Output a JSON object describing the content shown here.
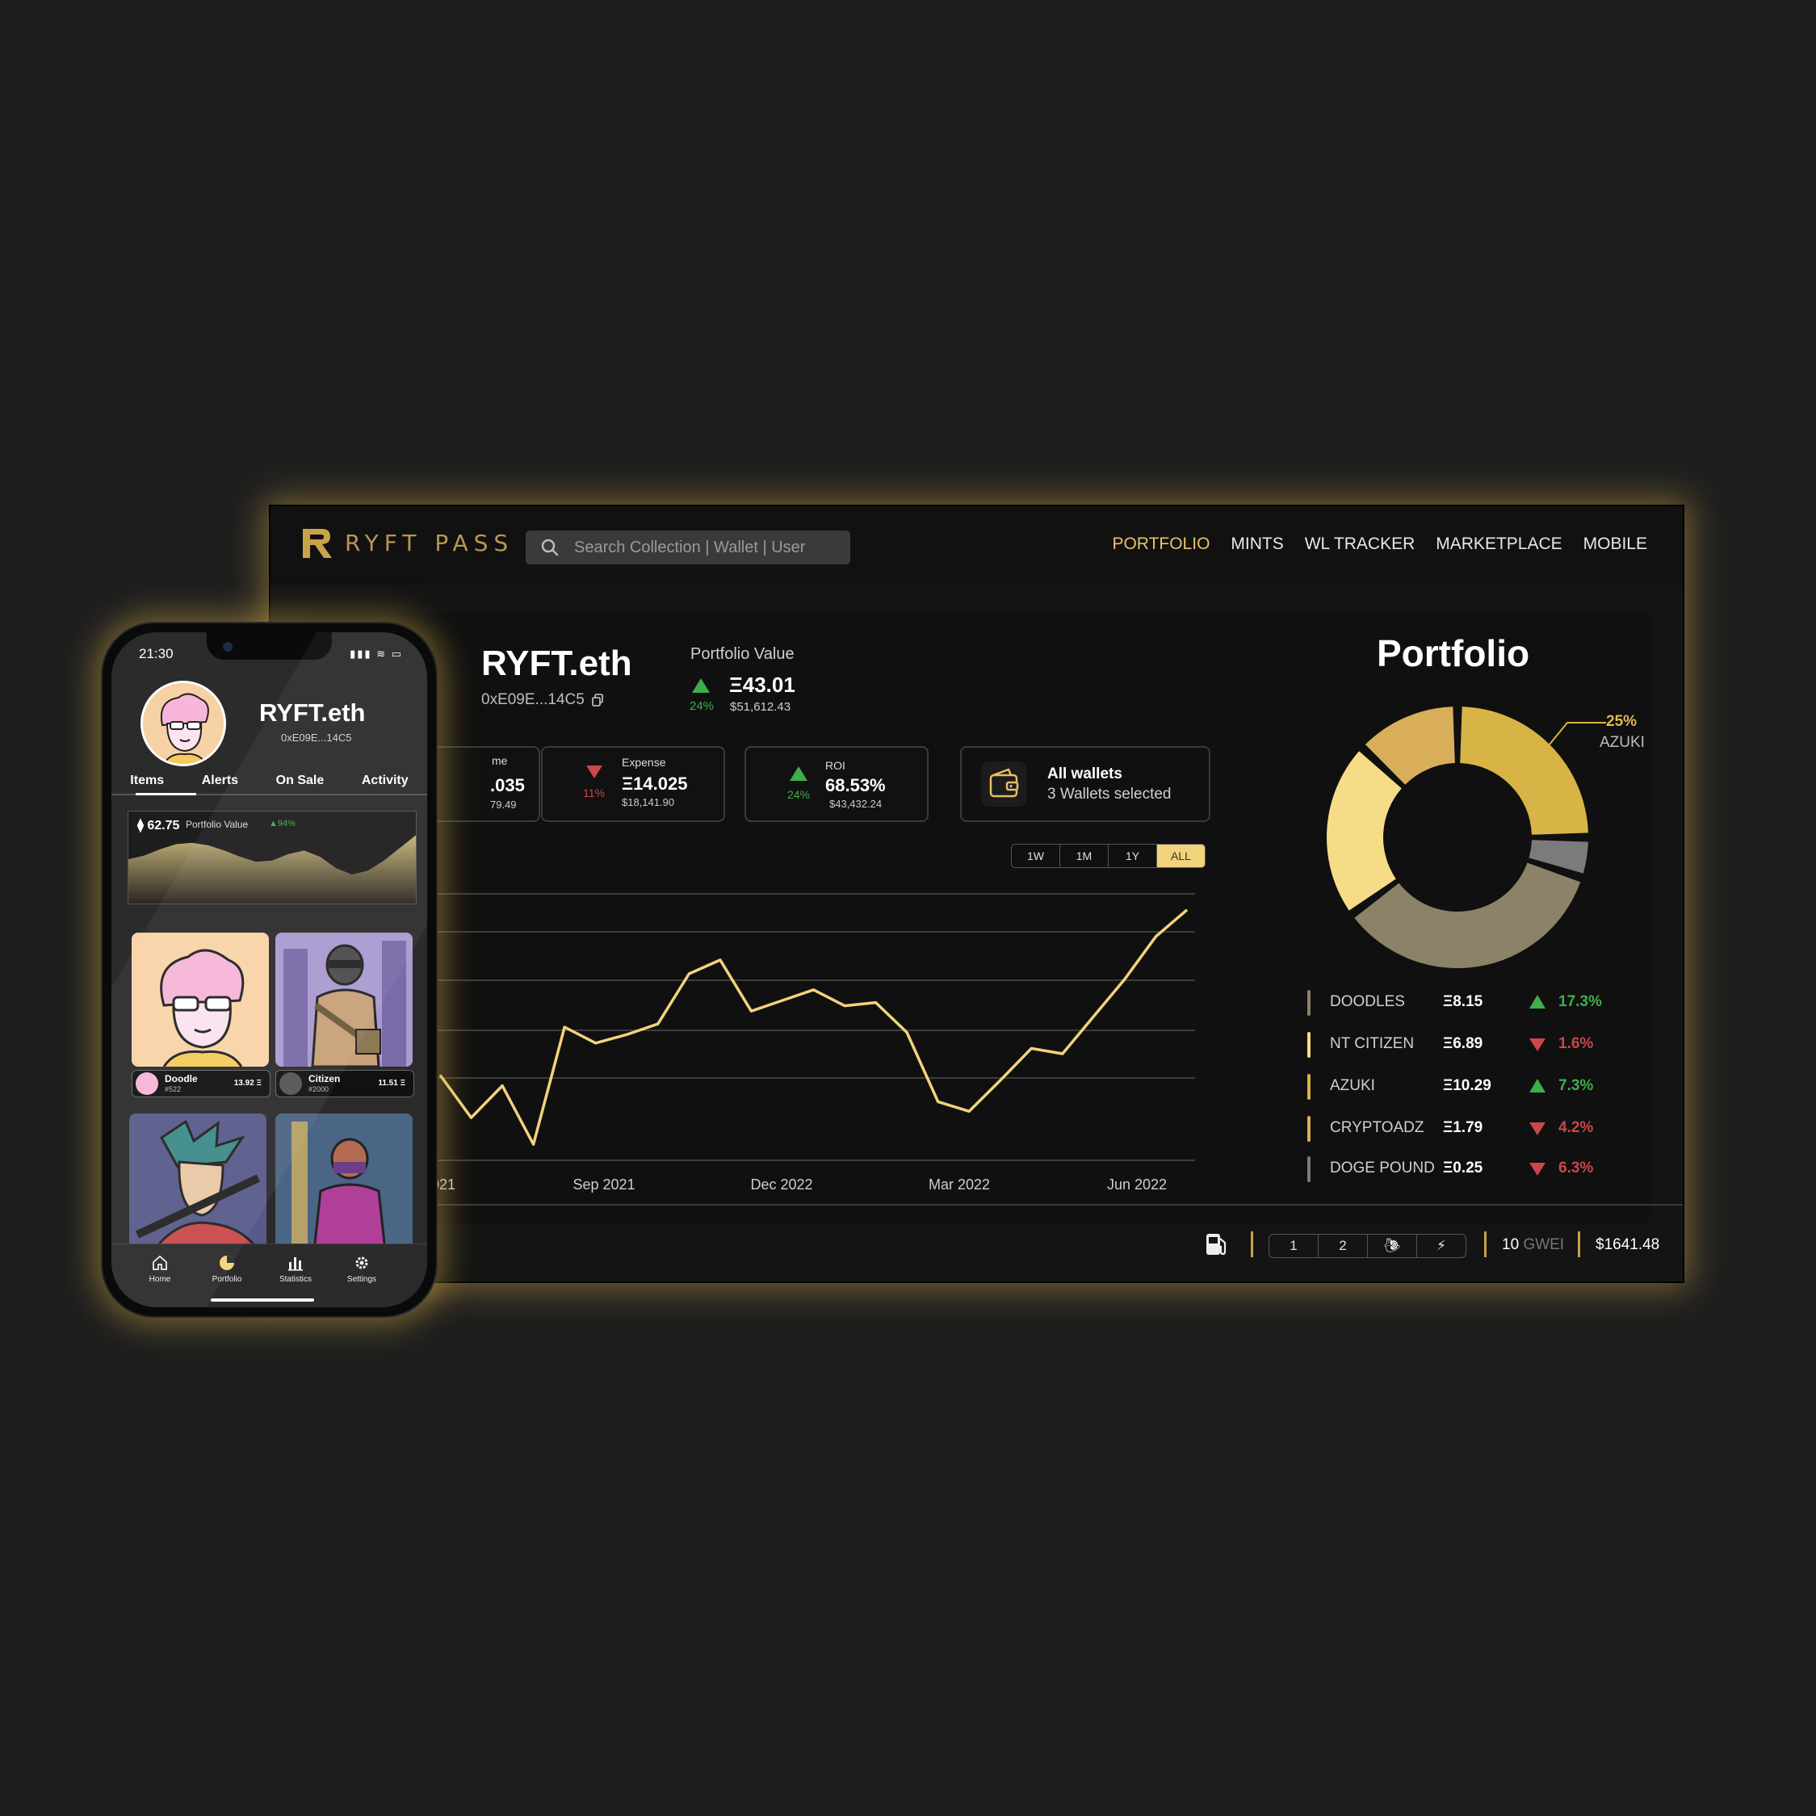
{
  "desktop": {
    "logo_text": "RYFT PASS",
    "search": {
      "placeholder": "Search Collection  |  Wallet  |  User"
    },
    "nav": [
      {
        "label": "PORTFOLIO",
        "active": true
      },
      {
        "label": "MINTS",
        "active": false
      },
      {
        "label": "WL TRACKER",
        "active": false
      },
      {
        "label": "MARKETPLACE",
        "active": false
      },
      {
        "label": "MOBILE",
        "active": false
      }
    ],
    "account": {
      "name": "RYFT.eth",
      "address": "0xE09E...14C5"
    },
    "portfolio_value": {
      "label": "Portfolio Value",
      "change_pct": "24%",
      "eth": "Ξ43.01",
      "usd": "$51,612.43"
    },
    "cards": {
      "income": {
        "label": "me",
        "value": ".035",
        "sub": "79.49"
      },
      "expense": {
        "label": "Expense",
        "pct": "11%",
        "value": "Ξ14.025",
        "sub": "$18,141.90"
      },
      "roi": {
        "label": "ROI",
        "pct": "24%",
        "value": "68.53%",
        "sub": "$43,432.24"
      }
    },
    "wallets": {
      "title": "All wallets",
      "subtitle": "3 Wallets selected"
    },
    "ranges": [
      {
        "label": "1W",
        "active": false
      },
      {
        "label": "1M",
        "active": false
      },
      {
        "label": "1Y",
        "active": false
      },
      {
        "label": "ALL",
        "active": true
      }
    ],
    "portfolio_title": "Portfolio",
    "donut_callout": {
      "pct": "25%",
      "label": "AZUKI"
    },
    "holdings": [
      {
        "name": "DOODLES",
        "value": "Ξ8.15",
        "change": "17.3%",
        "direction": "up",
        "color": "#8b8268"
      },
      {
        "name": "NT CITIZEN",
        "value": "Ξ6.89",
        "change": "1.6%",
        "direction": "down",
        "color": "#f6dc86"
      },
      {
        "name": "AZUKI",
        "value": "Ξ10.29",
        "change": "7.3%",
        "direction": "up",
        "color": "#d8b446"
      },
      {
        "name": "CRYPTOADZ",
        "value": "Ξ1.79",
        "change": "4.2%",
        "direction": "down",
        "color": "#d9ae5a"
      },
      {
        "name": "DOGE POUND",
        "value": "Ξ0.25",
        "change": "6.3%",
        "direction": "down",
        "color": "#7b7b7b"
      }
    ],
    "footer": {
      "speeds": [
        "1",
        "2",
        "snail-icon",
        "bolt-icon"
      ],
      "gwei_value": "10",
      "gwei_unit": "GWEI",
      "eth_price": "$1641.48"
    }
  },
  "chart_data": [
    {
      "type": "line",
      "title": "",
      "xlabel": "",
      "ylabel": "",
      "x_ticks": [
        "021",
        "Sep 2021",
        "Dec 2022",
        "Mar 2022",
        "Jun 2022"
      ],
      "grid": true,
      "series": [
        {
          "values": [
            13,
            9,
            12,
            6.5,
            17.5,
            16,
            16.8,
            17.8,
            22.5,
            23.8,
            19,
            20,
            21,
            19.5,
            19.8,
            17,
            10.5,
            9.6,
            12.5,
            15.5,
            15,
            18.5,
            22,
            26,
            28.5
          ]
        }
      ],
      "line_color": "#f2d27c"
    },
    {
      "type": "pie",
      "title": "Portfolio",
      "labels": [
        "AZUKI",
        "DOGE POUND",
        "DOODLES",
        "NT CITIZEN",
        "CRYPTOADZ"
      ],
      "values": [
        25,
        5,
        35,
        22,
        13
      ],
      "colors": [
        "#d8b446",
        "#7b7b7b",
        "#8b8268",
        "#f6dc86",
        "#d9ae5a"
      ]
    },
    {
      "type": "area",
      "title": "",
      "series": [
        {
          "values": [
            35,
            38,
            43,
            47,
            48,
            46,
            42,
            37,
            33,
            34,
            39,
            42,
            37,
            28,
            23,
            26,
            34,
            44,
            54
          ]
        }
      ]
    }
  ],
  "mobile": {
    "time": "21:30",
    "status": "▮▮▮ ≋ ▭",
    "name": "RYFT.eth",
    "address": "0xE09E...14C5",
    "tabs": [
      "Items",
      "Alerts",
      "On Sale",
      "Activity"
    ],
    "portfolio": {
      "value": "62.75",
      "label": "Portfolio Value",
      "pct": "▲94%"
    },
    "nfts": [
      {
        "name": "Doodle",
        "id": "#522",
        "price": "13.92 Ξ"
      },
      {
        "name": "Citizen",
        "id": "#2000",
        "price": "11.51 Ξ"
      }
    ],
    "tabbar": [
      {
        "label": "Home",
        "icon": "home-icon"
      },
      {
        "label": "Portfolio",
        "icon": "pie-icon"
      },
      {
        "label": "Statistics",
        "icon": "bar-chart-icon"
      },
      {
        "label": "Settings",
        "icon": "gear-icon"
      }
    ]
  }
}
